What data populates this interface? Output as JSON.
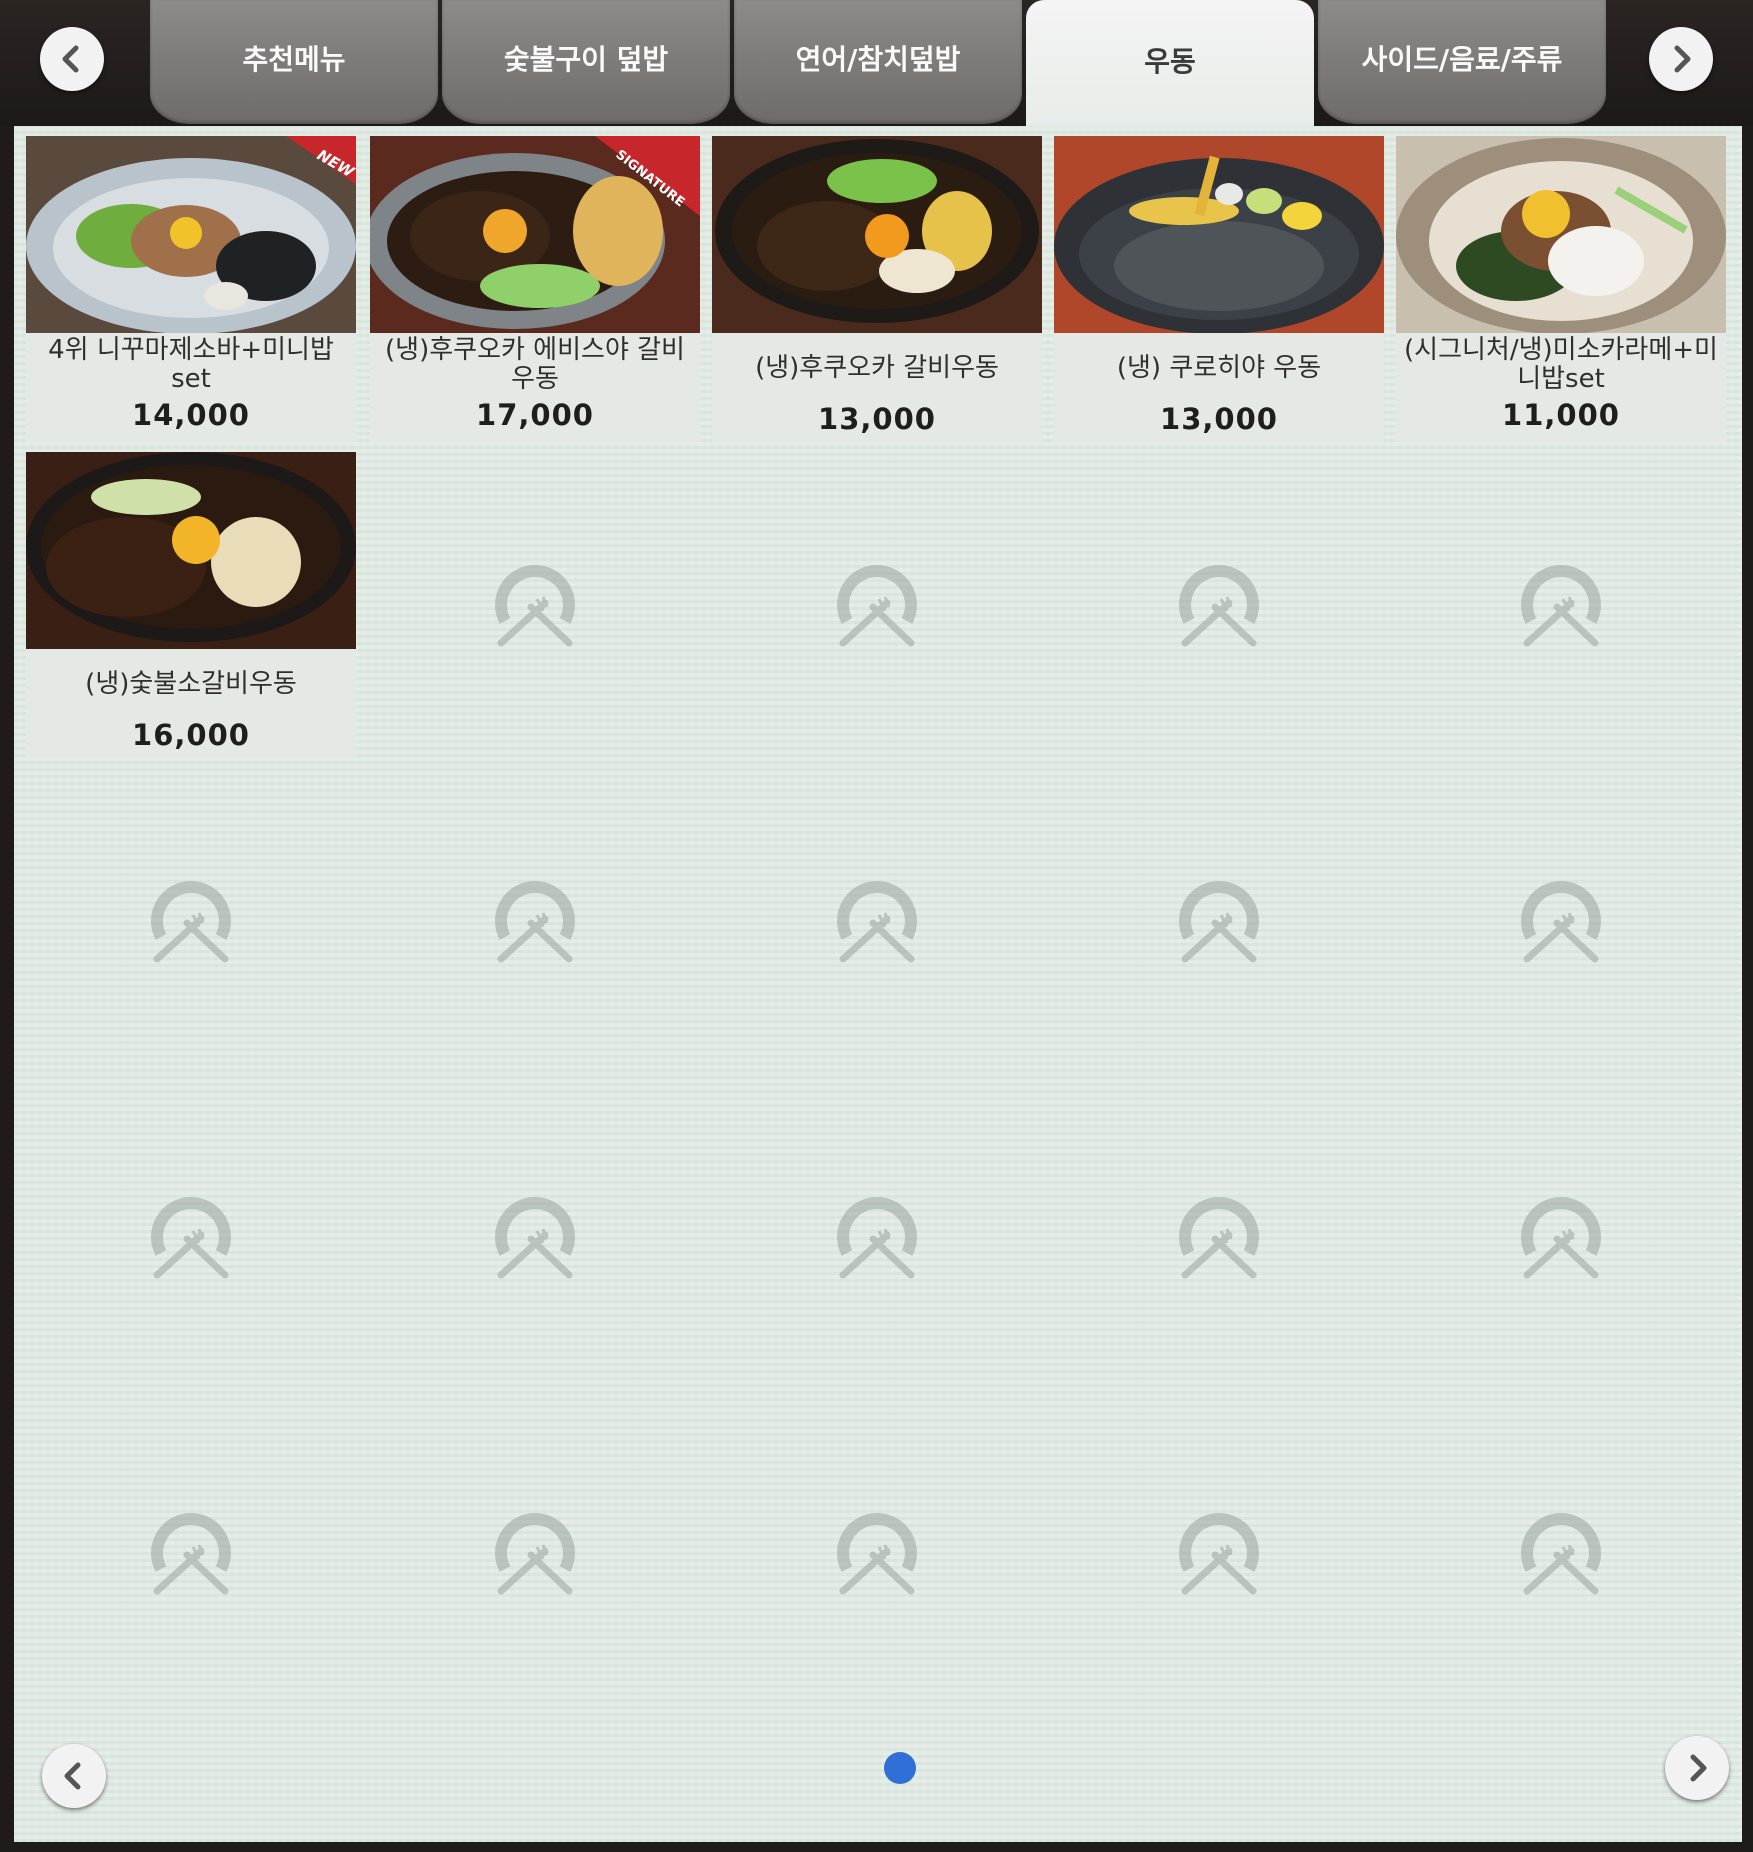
{
  "tabs": [
    {
      "label": "추천메뉴",
      "active": false
    },
    {
      "label": "숯불구이 덮밥",
      "active": false
    },
    {
      "label": "연어/참치덮밥",
      "active": false
    },
    {
      "label": "우동",
      "active": true
    },
    {
      "label": "사이드/음료/주류",
      "active": false
    }
  ],
  "menu_items": [
    {
      "name": "4위 니꾸마제소바+미니밥set",
      "price": "14,000",
      "badge": "NEW"
    },
    {
      "name": "(냉)후쿠오카 에비스야 갈비우동",
      "price": "17,000",
      "badge": "SIGNATURE"
    },
    {
      "name": "(냉)후쿠오카 갈비우동",
      "price": "13,000",
      "badge": ""
    },
    {
      "name": "(냉) 쿠로히야 우동",
      "price": "13,000",
      "badge": ""
    },
    {
      "name": "(시그니처/냉)미소카라메+미니밥set",
      "price": "11,000",
      "badge": ""
    },
    {
      "name": "(냉)숯불소갈비우동",
      "price": "16,000",
      "badge": ""
    }
  ],
  "pagination": {
    "current_page": 1,
    "total_pages": 1
  },
  "icons": {
    "tab_prev": "chevron-left-icon",
    "tab_next": "chevron-right-icon",
    "page_prev": "chevron-left-icon",
    "page_next": "chevron-right-icon",
    "placeholder": "restaurant-logo-icon"
  },
  "colors": {
    "accent_dot": "#2f6fd6",
    "active_tab": "#f4f4f4",
    "inactive_tab": "#7f7b79"
  }
}
